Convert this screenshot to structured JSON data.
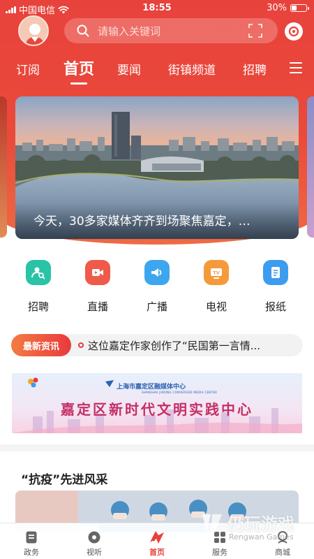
{
  "status_bar": {
    "carrier": "中国电信",
    "time": "18:55",
    "battery": "30%"
  },
  "header": {
    "search_placeholder": "请输入关键词",
    "tabs": [
      "订阅",
      "首页",
      "要闻",
      "街镇频道",
      "招聘"
    ],
    "active_tab": "首页"
  },
  "banner": {
    "caption": "今天，30多家媒体齐齐到场聚焦嘉定，…"
  },
  "services": [
    {
      "label": "招聘",
      "icon": "recruit-icon",
      "color": "#29c3a6"
    },
    {
      "label": "直播",
      "icon": "live-icon",
      "color": "#f05a4a"
    },
    {
      "label": "广播",
      "icon": "broadcast-icon",
      "color": "#3ea6ee"
    },
    {
      "label": "电视",
      "icon": "tv-icon",
      "color": "#f59a3a"
    },
    {
      "label": "报纸",
      "icon": "newspaper-icon",
      "color": "#3d9cf0"
    }
  ],
  "ticker": {
    "tag": "最新资讯",
    "text": "这位嘉定作家创作了“民国第一言情..."
  },
  "ad": {
    "org": "上海市嘉定区融媒体中心",
    "org_en": "SHANGHAI JIADING CONVERGED MEDIA CENTER",
    "title": "嘉定区新时代文明实践中心"
  },
  "section": {
    "title": "“抗疫”先进风采"
  },
  "bottom_nav": [
    {
      "label": "政务",
      "icon": "document-icon"
    },
    {
      "label": "视听",
      "icon": "disc-icon"
    },
    {
      "label": "首页",
      "icon": "home-logo-icon",
      "active": true
    },
    {
      "label": "服务",
      "icon": "grid-icon"
    },
    {
      "label": "商城",
      "icon": "shop-icon"
    }
  ],
  "watermark": {
    "cn": "仍玩游戏",
    "en": "Rengwan Games"
  },
  "colors": {
    "brand_red": "#e8423c",
    "accent_orange": "#f37c42"
  }
}
